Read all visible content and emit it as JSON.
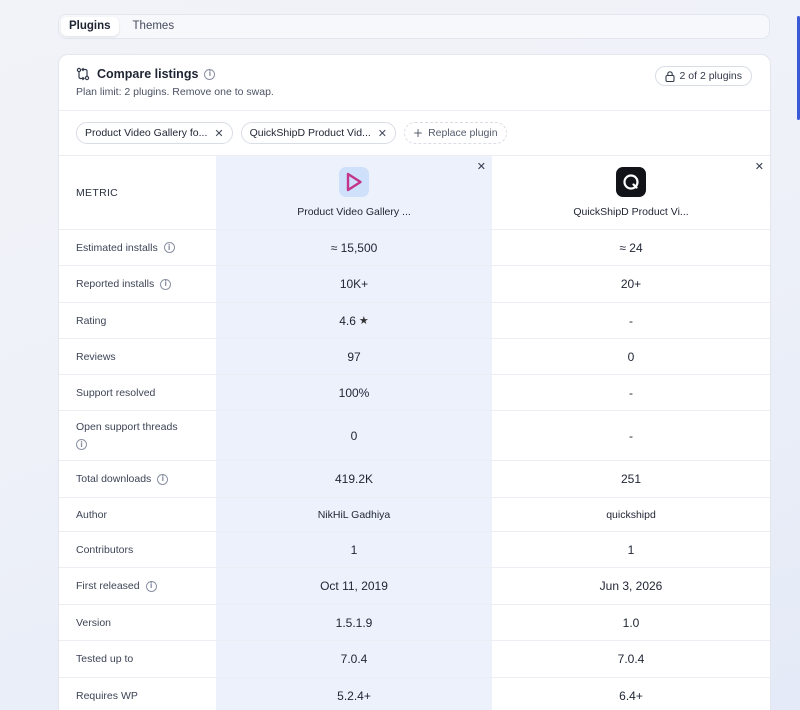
{
  "tabs": [
    {
      "label": "Plugins",
      "active": true
    },
    {
      "label": "Themes",
      "active": false
    }
  ],
  "header": {
    "title": "Compare listings",
    "subtitle": "Plan limit: 2 plugins. Remove one to swap.",
    "count_badge": "2 of 2 plugins"
  },
  "chips": [
    {
      "label": "Product Video Gallery fo..."
    },
    {
      "label": "QuickShipD Product Vid..."
    }
  ],
  "replace_label": "Replace plugin",
  "table": {
    "metric_header": "METRIC",
    "plugins": [
      {
        "name": "Product Video Gallery ...",
        "highlighted": true
      },
      {
        "name": "QuickShipD Product Vi..."
      }
    ],
    "rows": [
      {
        "metric": "Estimated installs",
        "info": true,
        "a": "≈ 15,500",
        "b": "≈ 24"
      },
      {
        "metric": "Reported installs",
        "info": true,
        "a": "10K+",
        "b": "20+"
      },
      {
        "metric": "Rating",
        "info": false,
        "a": "4.6",
        "b": "-"
      },
      {
        "metric": "Reviews",
        "info": false,
        "a": "97",
        "b": "0"
      },
      {
        "metric": "Support resolved",
        "info": false,
        "a": "100%",
        "b": "-"
      },
      {
        "metric": "Open support threads",
        "info": true,
        "a": "0",
        "b": "-"
      },
      {
        "metric": "Total downloads",
        "info": true,
        "a": "419.2K",
        "b": "251"
      },
      {
        "metric": "Author",
        "info": false,
        "a": "NikHiL Gadhiya",
        "b": "quickshipd"
      },
      {
        "metric": "Contributors",
        "info": false,
        "a": "1",
        "b": "1"
      },
      {
        "metric": "First released",
        "info": true,
        "a": "Oct 11, 2019",
        "b": "Jun 3, 2026"
      },
      {
        "metric": "Version",
        "info": false,
        "a": "1.5.1.9",
        "b": "1.0"
      },
      {
        "metric": "Tested up to",
        "info": false,
        "a": "7.0.4",
        "b": "7.0.4"
      },
      {
        "metric": "Requires WP",
        "info": false,
        "a": "5.2.4+",
        "b": "6.4+"
      }
    ]
  },
  "colors": {
    "highlight_column": "#ecf1fc",
    "logo_a_bg": "#cfe0fb",
    "logo_a_accent": "#c3348a",
    "logo_b_bg": "#111318"
  },
  "icons": {
    "compare": "compare-arrows-icon",
    "info": "info-icon",
    "lock": "lock-icon",
    "close": "close-icon",
    "plus": "plus-icon",
    "star": "star-icon"
  }
}
